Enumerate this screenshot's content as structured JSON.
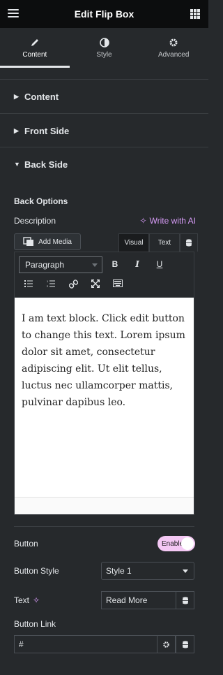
{
  "header": {
    "title": "Edit Flip Box"
  },
  "tabs": [
    {
      "label": "Content",
      "icon": "pencil-icon"
    },
    {
      "label": "Style",
      "icon": "contrast-icon"
    },
    {
      "label": "Advanced",
      "icon": "gear-icon"
    }
  ],
  "sections": [
    {
      "label": "Content"
    },
    {
      "label": "Front Side"
    },
    {
      "label": "Back Side"
    }
  ],
  "back": {
    "options_label": "Back Options",
    "description_label": "Description",
    "ai_label": "Write with AI",
    "add_media": "Add Media",
    "editor_tabs": [
      "Visual",
      "Text"
    ],
    "format": "Paragraph",
    "bold": "B",
    "italic": "I",
    "underline": "U",
    "text": "I am text block. Click edit button to change this text. Lorem ipsum dolor sit amet, consectetur adipiscing elit. Ut elit tellus, luctus nec ullamcorper mattis, pulvinar dapibus leo.",
    "button_label": "Button",
    "button_toggle": "Enable",
    "button_style_label": "Button Style",
    "button_style_value": "Style 1",
    "text_label": "Text",
    "text_value": "Read More",
    "link_label": "Button Link",
    "link_value": "#"
  },
  "colors": {
    "accent_ai": "#d69bf6",
    "toggle_on": "#f4c8f4"
  }
}
